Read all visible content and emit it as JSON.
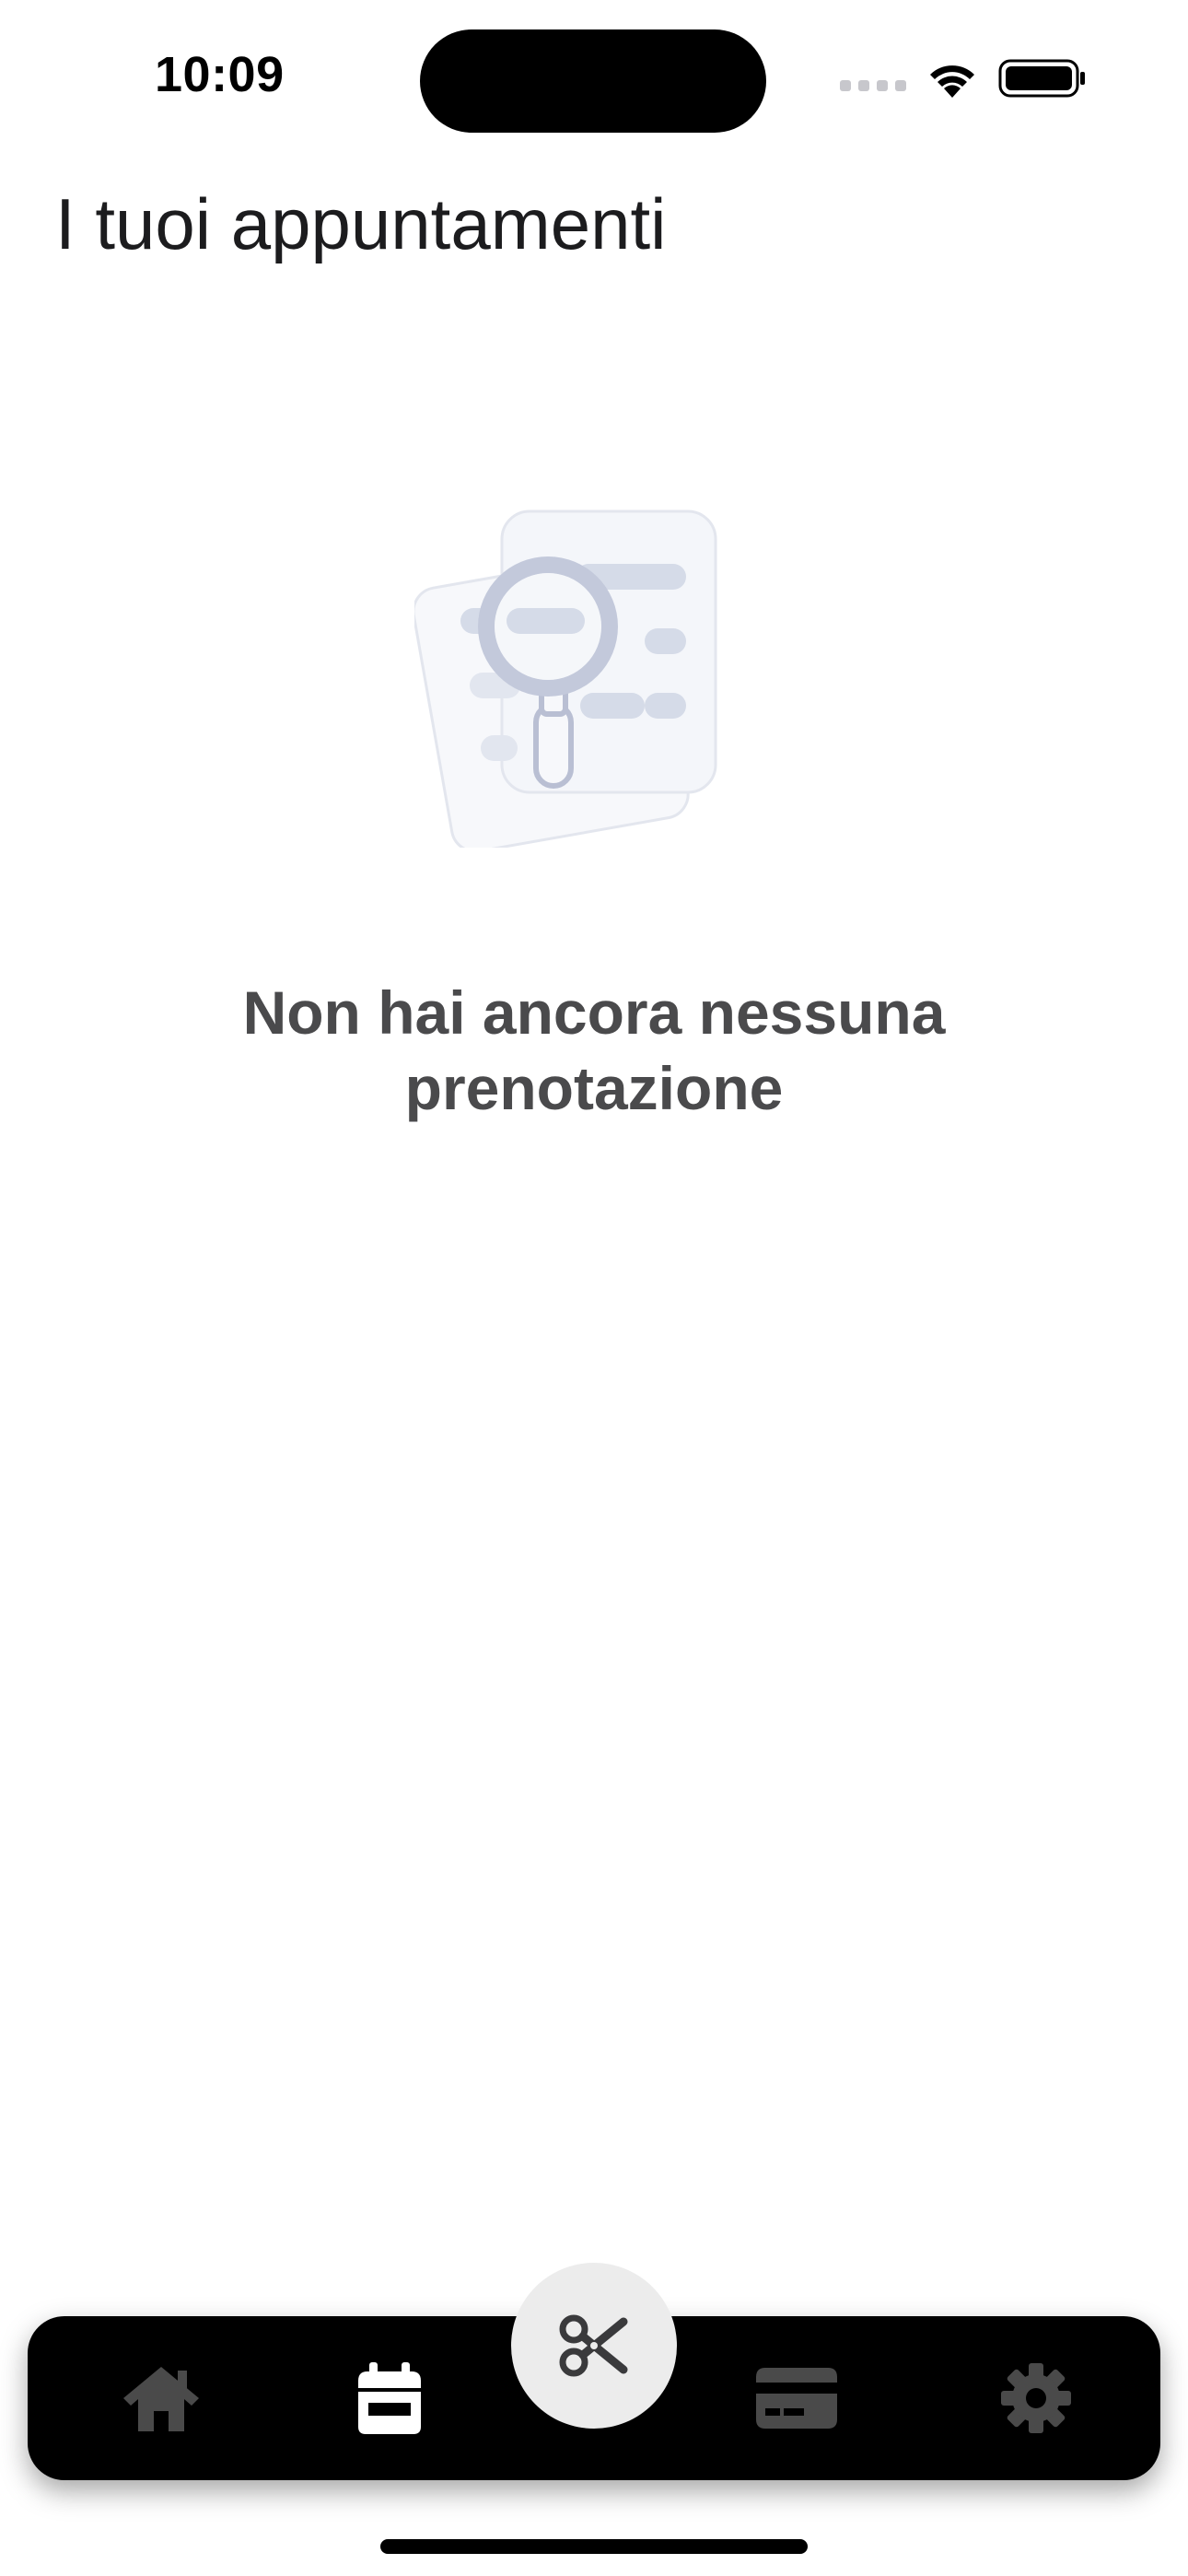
{
  "status_bar": {
    "time": "10:09"
  },
  "page": {
    "title": "I tuoi appuntamenti"
  },
  "empty_state": {
    "illustration_icon": "document-search-icon",
    "message": "Non hai ancora nessuna prenotazione"
  },
  "tab_bar": {
    "items": [
      {
        "icon": "home-icon",
        "active": false
      },
      {
        "icon": "calendar-icon",
        "active": true
      },
      {
        "icon": "scissors-icon",
        "active": false
      },
      {
        "icon": "credit-card-icon",
        "active": false
      },
      {
        "icon": "gear-icon",
        "active": false
      }
    ]
  },
  "colors": {
    "tab_bar_background": "#000000",
    "tab_active": "#ffffff",
    "tab_inactive": "#4a4a4a",
    "fab_background": "#ececec",
    "fab_icon": "#3a3a3c",
    "message_text": "#4a4a4c",
    "illustration_accent": "#d5dbe8"
  }
}
